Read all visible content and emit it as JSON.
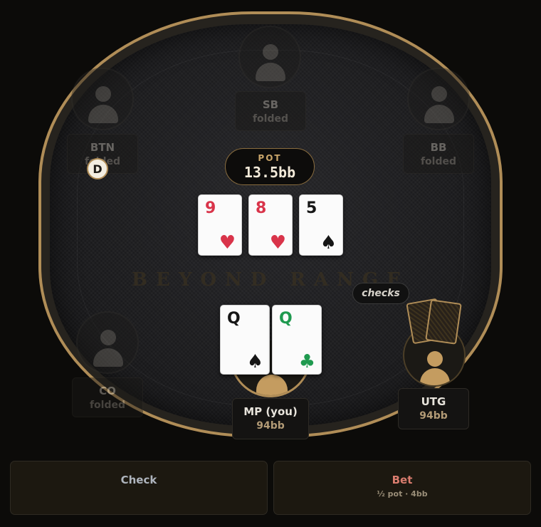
{
  "table": {
    "watermark": "BEYOND RANGE",
    "pot": {
      "label": "POT",
      "amount": "13.5bb"
    },
    "board": [
      {
        "rank": "9",
        "suit": "♥",
        "color": "#d9344a"
      },
      {
        "rank": "8",
        "suit": "♥",
        "color": "#d9344a"
      },
      {
        "rank": "5",
        "suit": "♠",
        "color": "#161616"
      }
    ],
    "dealer_button": "D"
  },
  "seats": {
    "sb": {
      "name": "SB",
      "status": "folded"
    },
    "btn": {
      "name": "BTN",
      "status": "folded"
    },
    "bb": {
      "name": "BB",
      "status": "folded"
    },
    "co": {
      "name": "CO",
      "status": "folded"
    },
    "utg": {
      "name": "UTG",
      "stack": "94bb",
      "action": "checks"
    },
    "hero": {
      "name": "MP (you)",
      "stack": "94bb",
      "cards": [
        {
          "rank": "Q",
          "suit": "♠",
          "color": "#161616"
        },
        {
          "rank": "Q",
          "suit": "♣",
          "color": "#1f9a4f"
        }
      ]
    }
  },
  "actions": {
    "check": {
      "label": "Check",
      "color": "#aeb4bd"
    },
    "bet": {
      "label": "Bet",
      "sublabel": "½ pot · 4bb",
      "color": "#d97c6e"
    }
  },
  "icons": [
    "user-icon",
    "card-back",
    "dealer-button"
  ]
}
